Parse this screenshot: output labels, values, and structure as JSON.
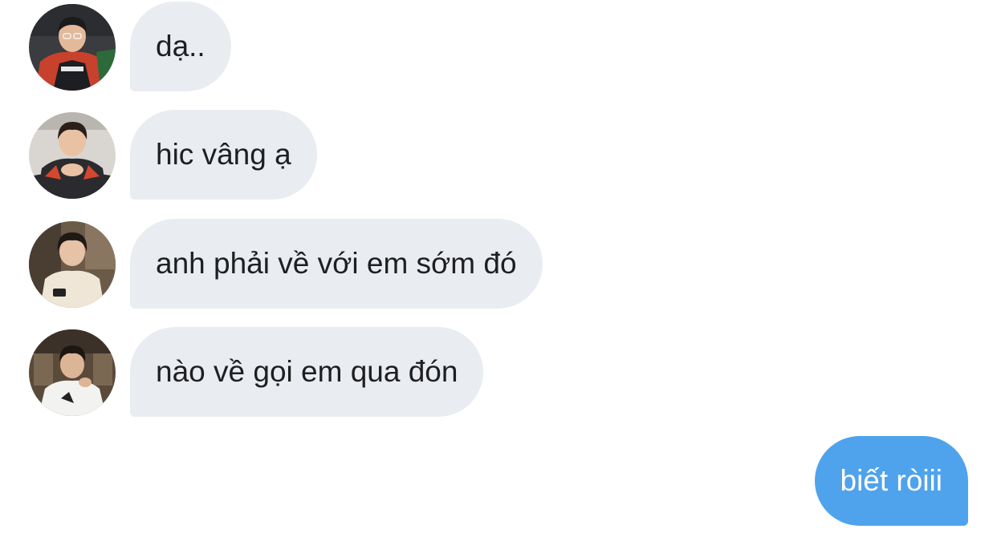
{
  "conversation": {
    "incoming": [
      {
        "text": "dạ..",
        "avatar": "profile-photo-gamer-jersey"
      },
      {
        "text": "hic vâng ạ",
        "avatar": "profile-photo-gamer-seated"
      },
      {
        "text": "anh phải về với em sớm đó",
        "avatar": "profile-photo-white-shirt"
      },
      {
        "text": "nào về gọi em qua đón",
        "avatar": "profile-photo-restaurant"
      }
    ],
    "outgoing": [
      {
        "text": "biết ròiii"
      }
    ]
  },
  "colors": {
    "incoming_bubble": "#e9ecf0",
    "outgoing_bubble": "#4fa3ec",
    "incoming_text": "#1f1f21",
    "outgoing_text": "#ffffff"
  }
}
